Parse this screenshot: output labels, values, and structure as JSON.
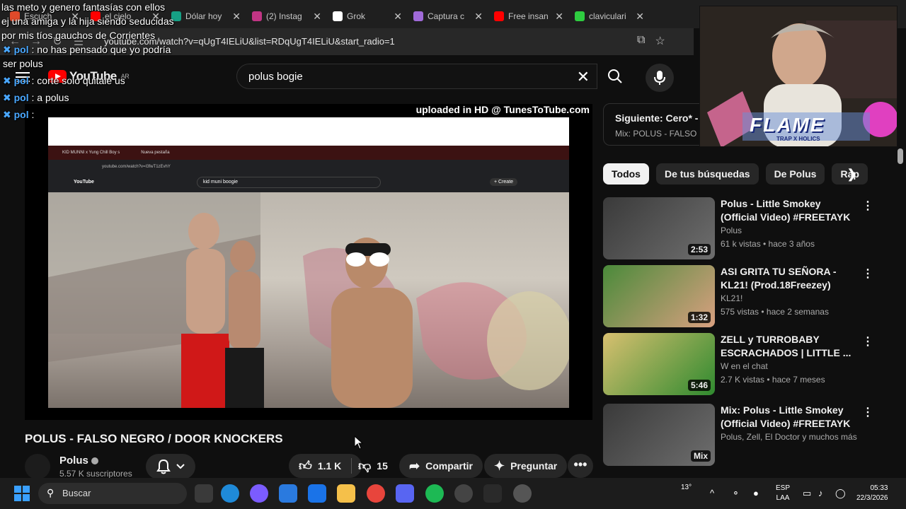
{
  "browser": {
    "tabs": [
      {
        "label": "Escuch",
        "color": "#e04a2a"
      },
      {
        "label": "el cielo",
        "color": "#ff0000"
      },
      {
        "label": "Dólar hoy",
        "color": "#16a085"
      },
      {
        "label": "(2) Instag",
        "color": "#c13584"
      },
      {
        "label": "Grok",
        "color": "#ffffff"
      },
      {
        "label": "Captura c",
        "color": "#a06ad8"
      },
      {
        "label": "Free insan",
        "color": "#ff0000"
      },
      {
        "label": "claviculari",
        "color": "#2ecc40"
      }
    ],
    "url": "youtube.com/watch?v=qUgT4IELiU&list=RDqUgT4IELiU&start_radio=1"
  },
  "youtube": {
    "logo_text": "YouTube",
    "region": "AR",
    "search_value": "polus bogie",
    "video_overlay": "uploaded in HD @ TunesToTube.com",
    "inner_video": {
      "tab_label": "KID MUNNI x Yung Chill Boy s",
      "tab2_label": "Nueva pestaña",
      "url": "youtube.com/watch?v=I3fwT1zEvhY",
      "search": "kid muni boogie",
      "create": "+ Create"
    },
    "title": "POLUS - FALSO NEGRO / DOOR KNOCKERS",
    "channel": "Polus",
    "subscribers": "5.57 K suscriptores",
    "likes": "1.1 K",
    "dislikes": "15",
    "share": "Compartir",
    "ask": "Preguntar",
    "more": "•••"
  },
  "sidebar": {
    "next_label": "Siguiente: Cero* -",
    "next_sub": "Mix: POLUS - FALSO NEG",
    "chips": [
      "Todos",
      "De tus búsquedas",
      "De Polus",
      "Rap"
    ],
    "recommendations": [
      {
        "title": "Polus - Little Smokey (Official Video) #FREETAYK",
        "channel": "Polus",
        "meta": "61 k vistas • hace 3 años",
        "duration": "2:53",
        "colors": [
          "#3a3a3a",
          "#6e6e6e"
        ]
      },
      {
        "title": "ASI GRITA TU SEÑORA - KL21! (Prod.18Freezey)",
        "channel": "KL21!",
        "meta": "575 vistas • hace 2 semanas",
        "duration": "1:32",
        "colors": [
          "#4a8a3a",
          "#d9a080"
        ]
      },
      {
        "title": "ZELL y TURROBABY ESCRACHADOS | LITTLE ...",
        "channel": "W en el chat",
        "meta": "2.7 K vistas • hace 7 meses",
        "duration": "5:46",
        "colors": [
          "#d8c070",
          "#2f8a2f"
        ]
      },
      {
        "title": "Mix: Polus - Little Smokey (Official Video) #FREETAYK",
        "channel": "Polus, Zell, El Doctor y muchos más",
        "meta": "",
        "duration": "Mix",
        "colors": [
          "#3a3a3a",
          "#6e6e6e"
        ]
      }
    ]
  },
  "chat": {
    "header_lines": [
      "las meto y genero fantasías con ellos",
      "ej una amiga y la hija siendo seducidas",
      "por mis tíos gauchos de Corrientes"
    ],
    "messages": [
      {
        "user": "pol",
        "text": ": no has pensado que yo podría"
      },
      {
        "user": "",
        "text": "ser polus"
      },
      {
        "user": "pol",
        "text": ": corte solo quitale us"
      },
      {
        "user": "pol",
        "text": ": a polus"
      },
      {
        "user": "pol",
        "text": ":"
      }
    ]
  },
  "webcam": {
    "overlay_title": "FLAME",
    "overlay_sub": "TRAP X HOLICS"
  },
  "taskbar": {
    "search_placeholder": "Buscar",
    "temperature": "13°",
    "lang_1": "ESP",
    "lang_2": "LAA",
    "time": "05:33",
    "date": "22/3/2026"
  }
}
